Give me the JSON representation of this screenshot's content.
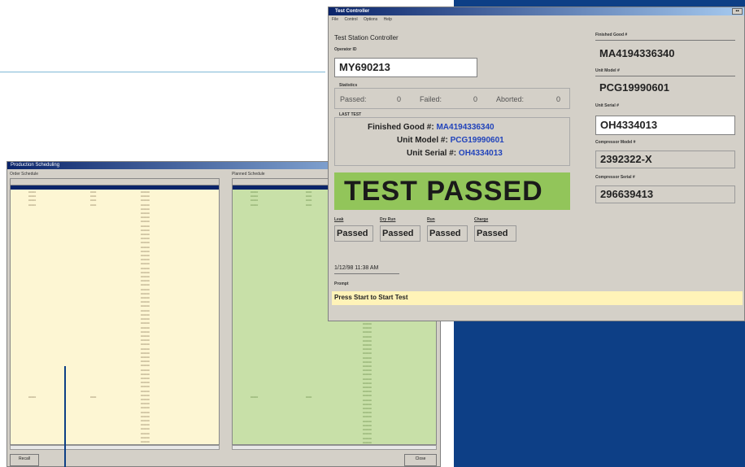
{
  "production_window": {
    "title": "Production Scheduling",
    "left_panel_label": "Order Schedule",
    "right_panel_label": "Planned Schedule",
    "left_button": "Recall",
    "right_button": "Close"
  },
  "test_controller": {
    "title": "Test Controller",
    "menu": [
      "File",
      "Control",
      "Options",
      "Help"
    ],
    "heading": "Test Station Controller",
    "operator_label": "Operator ID",
    "operator_value": "MY690213",
    "statistics_label": "Statistics",
    "passed_label": "Passed:",
    "passed_value": "0",
    "failed_label": "Failed:",
    "failed_value": "0",
    "aborted_label": "Aborted:",
    "aborted_value": "0",
    "last_test_label": "LAST TEST",
    "last_finished_label": "Finished Good #:",
    "last_finished_value": "MA4194336340",
    "last_model_label": "Unit Model #:",
    "last_model_value": "PCG19990601",
    "last_serial_label": "Unit Serial #:",
    "last_serial_value": "OH4334013",
    "result_text": "TEST PASSED",
    "tests": [
      {
        "label": "Leak",
        "value": "Passed"
      },
      {
        "label": "Dry Run",
        "value": "Passed"
      },
      {
        "label": "Run",
        "value": "Passed"
      },
      {
        "label": "Charge",
        "value": "Passed"
      }
    ],
    "timestamp": "1/12/98 11:38 AM",
    "prompt_label": "Prompt",
    "prompt_value": "Press Start to Start Test",
    "right_fields": [
      {
        "label": "Finished Good #",
        "value": "MA4194336340"
      },
      {
        "label": "Unit Model #",
        "value": "PCG19990601"
      },
      {
        "label": "Unit Serial #",
        "value": "OH4334013"
      },
      {
        "label": "Compressor Model #",
        "value": "2392322-X"
      },
      {
        "label": "Compressor Serial #",
        "value": "296639413"
      }
    ]
  },
  "colors": {
    "blue_panel": "#0d3f86",
    "pass_green": "#92c55a",
    "prompt_yellow": "#fff3b8",
    "yellow_panel": "#fdf6d3",
    "green_panel": "#c8e0a8"
  }
}
